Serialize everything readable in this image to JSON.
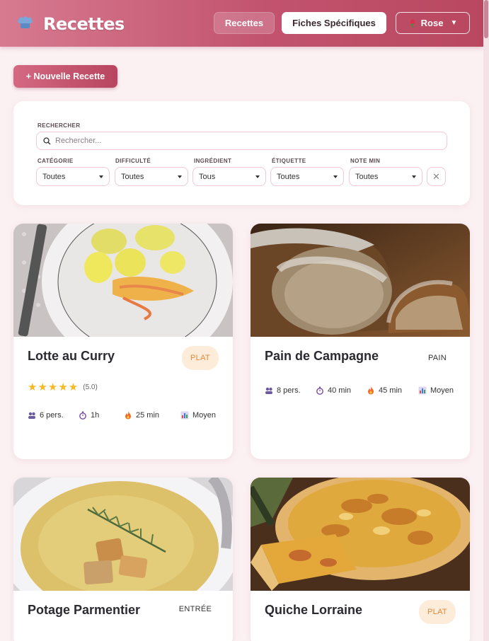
{
  "header": {
    "title": "Recettes",
    "nav": {
      "recettes": "Recettes",
      "fiches": "Fiches Spécifiques",
      "theme": "Rose"
    }
  },
  "actions": {
    "new_recipe": "+ Nouvelle Recette"
  },
  "filters": {
    "search_label": "RECHERCHER",
    "search_placeholder": "Rechercher...",
    "selects": [
      {
        "label": "CATÉGORIE",
        "value": "Toutes"
      },
      {
        "label": "DIFFICULTÉ",
        "value": "Toutes"
      },
      {
        "label": "INGRÉDIENT",
        "value": "Tous"
      },
      {
        "label": "ÉTIQUETTE",
        "value": "Toutes"
      },
      {
        "label": "NOTE MIN",
        "value": "Toutes"
      }
    ],
    "clear": "✕"
  },
  "recipes": [
    {
      "title": "Lotte au Curry",
      "category": "PLAT",
      "stars": "★★★★★",
      "rating": "(5.0)",
      "persons": "6 pers.",
      "prep": "1h",
      "cook": "25 min",
      "difficulty": "Moyen"
    },
    {
      "title": "Pain de Campagne",
      "category": "PAIN",
      "persons": "8 pers.",
      "prep": "40 min",
      "cook": "45 min",
      "difficulty": "Moyen"
    },
    {
      "title": "Potage Parmentier",
      "category": "ENTRÉE"
    },
    {
      "title": "Quiche Lorraine",
      "category": "PLAT"
    }
  ],
  "colors": {
    "accent": "#c2536f",
    "badge_bg": "#fdecd9",
    "badge_text": "#e08a3c",
    "star": "#f5b921",
    "background": "#fbf1f3"
  }
}
